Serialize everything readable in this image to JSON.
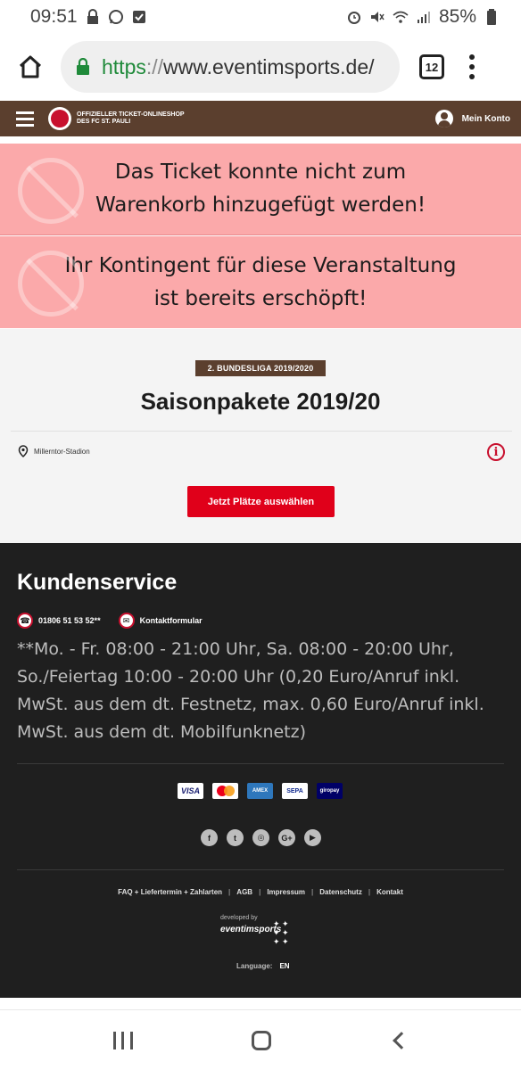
{
  "status_bar": {
    "time": "09:51",
    "battery": "85%"
  },
  "browser": {
    "url_scheme": "https",
    "url_sep": "://",
    "url_host": "www.eventimsports.de/",
    "tab_count": "12"
  },
  "header": {
    "shop_line1": "Offizieller Ticket-Onlineshop",
    "shop_line2": "des FC St. Pauli",
    "account_label": "Mein Konto"
  },
  "alerts": [
    {
      "text": "Das Ticket konnte nicht zum Warenkorb hinzugefügt werden!"
    },
    {
      "text": "Ihr Kontingent für diese Veranstaltung ist bereits erschöpft!"
    }
  ],
  "event": {
    "badge": "2. BUNDESLIGA 2019/2020",
    "title": "Saisonpakete 2019/20",
    "venue": "Millerntor-Stadion",
    "cta_label": "Jetzt Plätze auswählen"
  },
  "footer": {
    "title": "Kundenservice",
    "phone": "01806 51 53 52**",
    "contact_form": "Kontaktformular",
    "hours": "**Mo. - Fr. 08:00 - 21:00 Uhr, Sa. 08:00 - 20:00 Uhr, So./Feiertag 10:00 - 20:00 Uhr (0,20 Euro/Anruf inkl. MwSt. aus dem dt. Festnetz, max. 0,60 Euro/Anruf inkl. MwSt. aus dem dt. Mobilfunknetz)",
    "payments": [
      "VISA",
      "mastercard",
      "AMEX",
      "SEPA",
      "giropay"
    ],
    "socials": [
      "facebook-icon",
      "twitter-icon",
      "instagram-icon",
      "google-plus-icon",
      "youtube-icon"
    ],
    "links": [
      "FAQ + Liefertermin + Zahlarten",
      "AGB",
      "Impressum",
      "Datenschutz",
      "Kontakt"
    ],
    "developed_by": "developed by",
    "developer": "eventimsports",
    "language_label": "Language:",
    "language_value": "EN"
  }
}
